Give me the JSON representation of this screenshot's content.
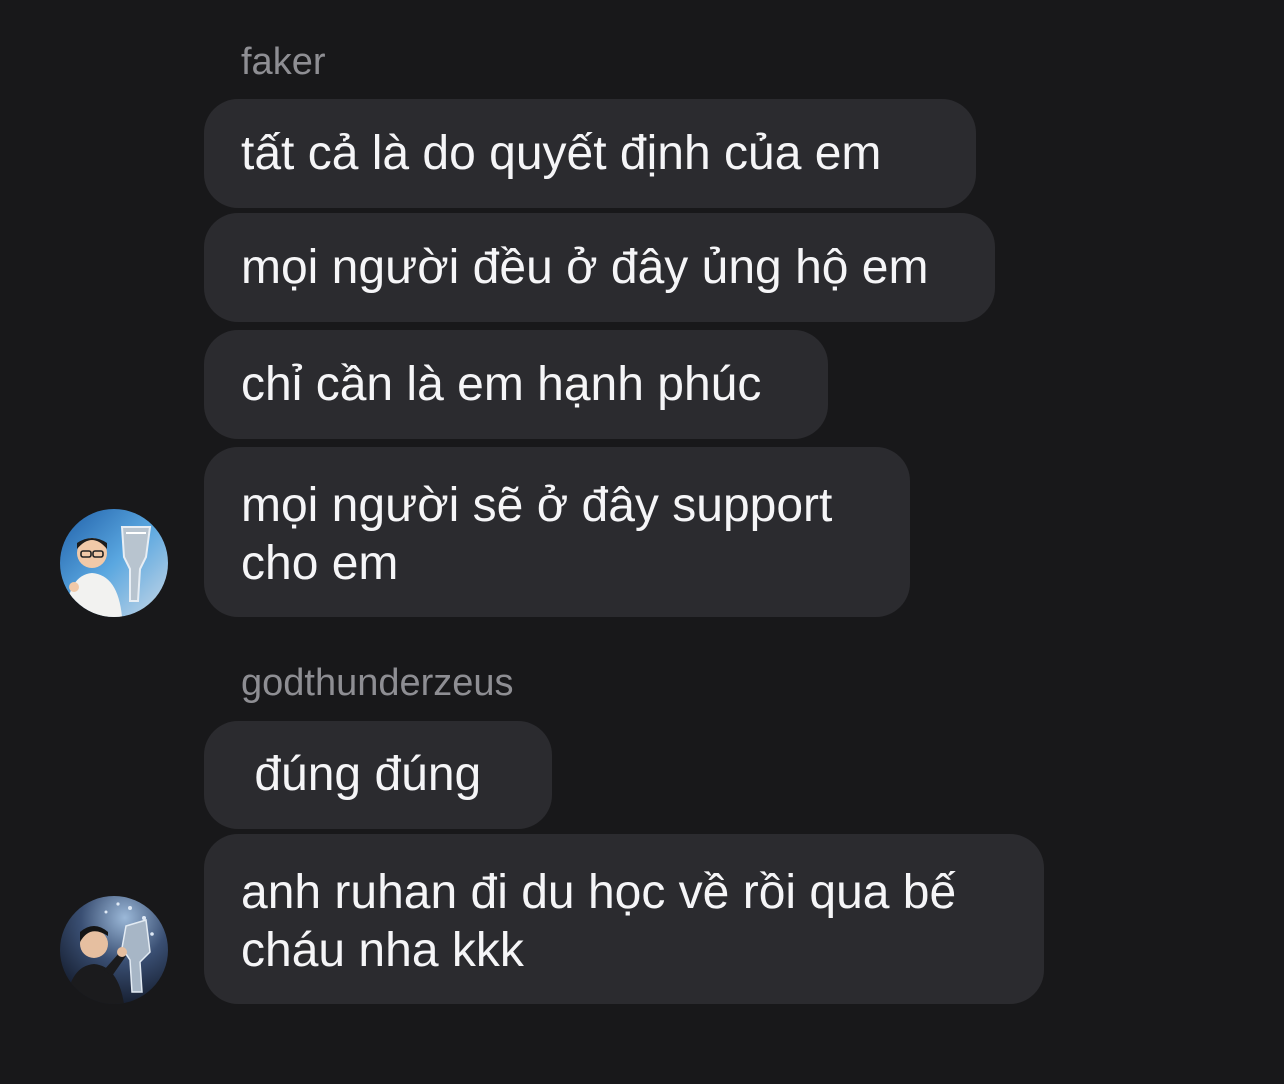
{
  "groups": [
    {
      "sender": "faker",
      "messages": [
        "tất cả là do quyết định của em",
        "mọi người đều ở đây ủng hộ em",
        "chỉ cần là em hạnh phúc",
        "mọi người sẽ ở đây support cho em"
      ]
    },
    {
      "sender": "godthunderzeus",
      "messages": [
        " đúng đúng",
        "anh ruhan đi du học về rồi qua bế cháu nha kkk"
      ]
    }
  ],
  "colors": {
    "background": "#18181a",
    "bubble": "#2b2b2f",
    "text": "#f5f5f7",
    "sender": "#8e8e93"
  },
  "avatars": [
    "avatar-faker-icon",
    "avatar-godthunderzeus-icon"
  ]
}
